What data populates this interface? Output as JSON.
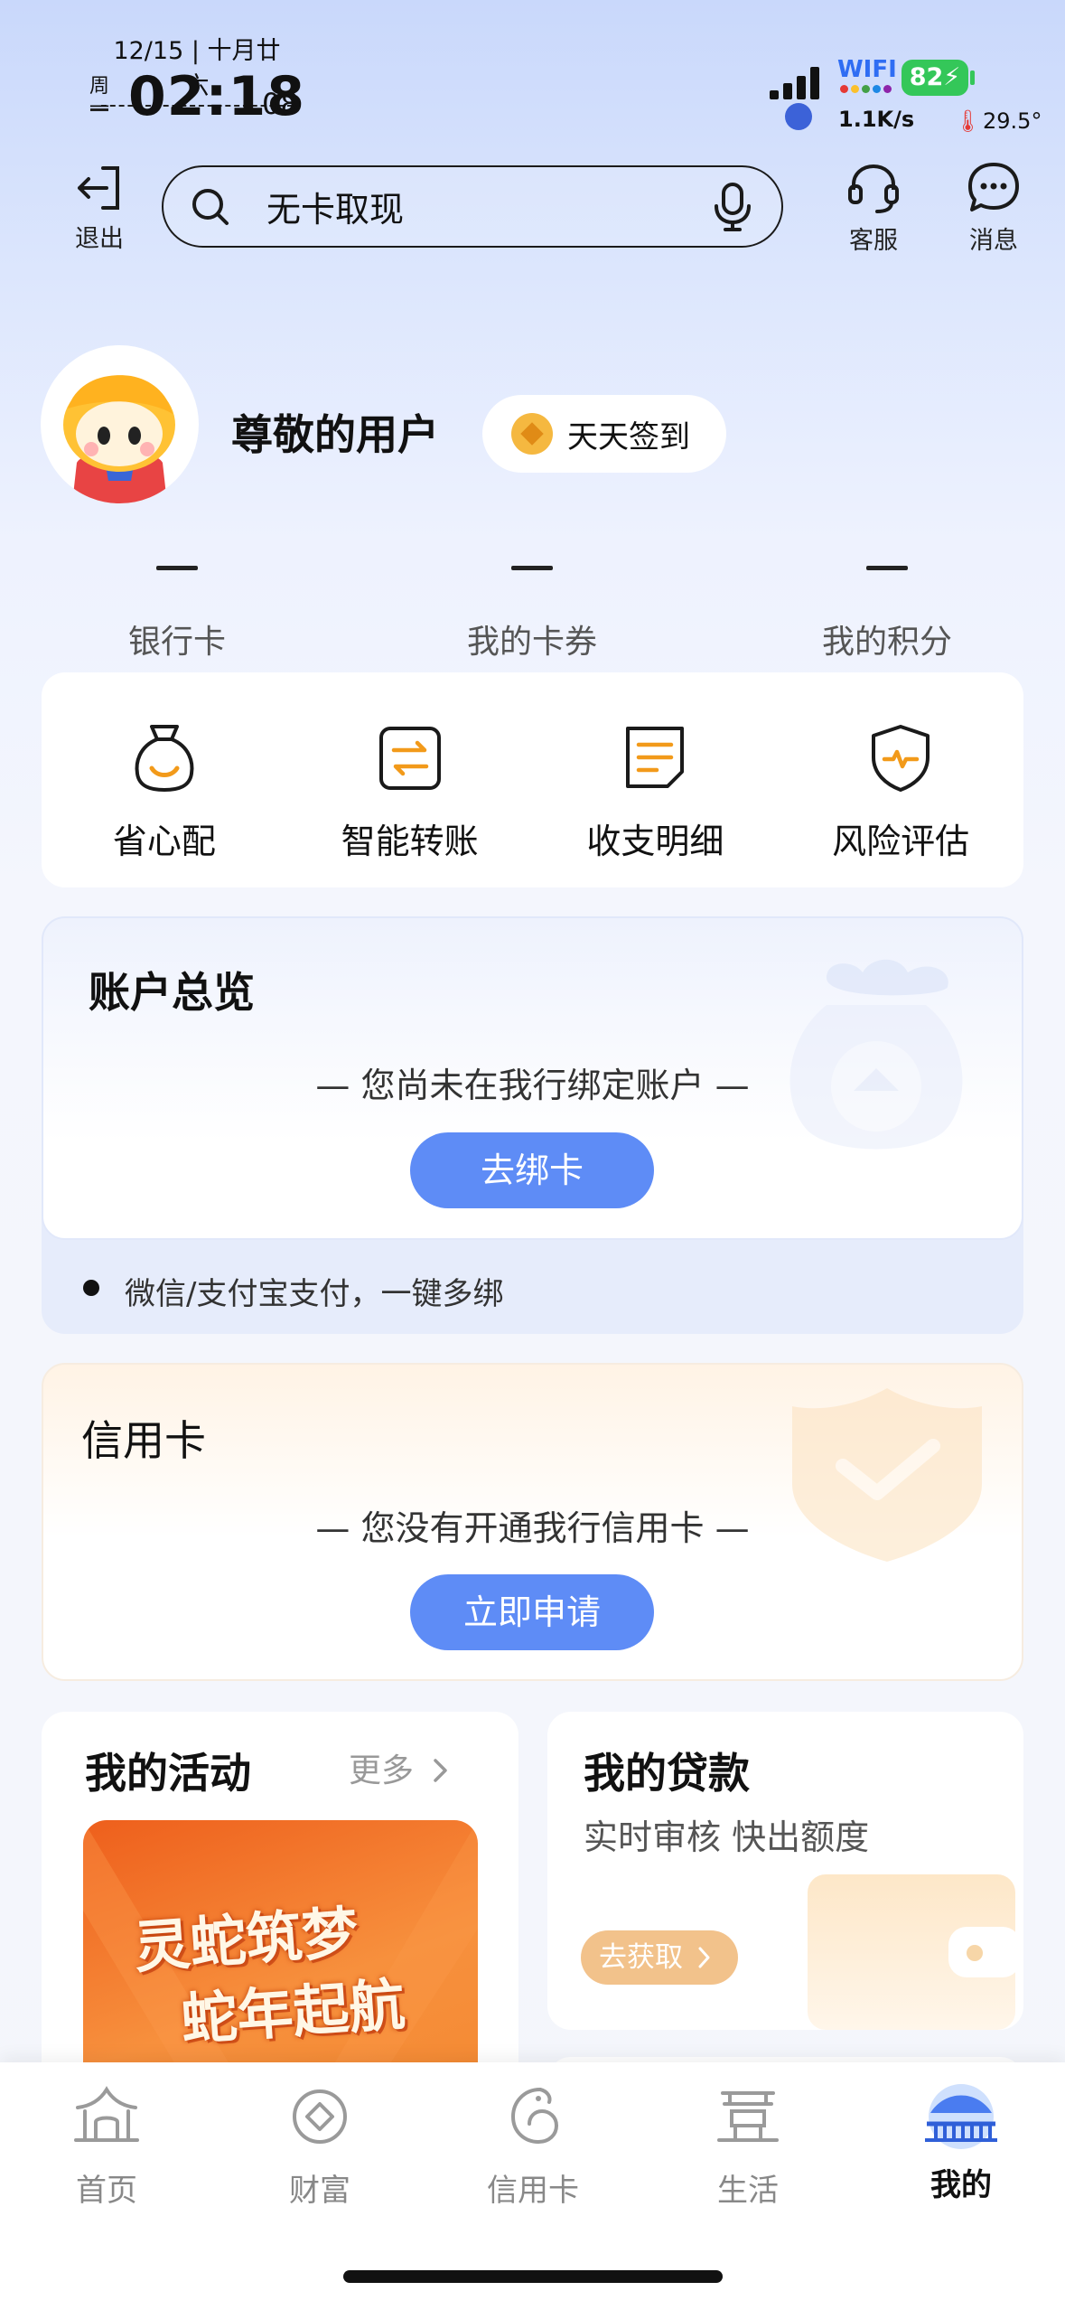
{
  "status_bar": {
    "date": "12/15 | 十月廿六",
    "weekday": "周一",
    "time": "02:18",
    "seconds": "08",
    "wifi_label": "WIFI",
    "battery": "82",
    "net_speed": "1.1K/s",
    "temperature": "29.5°"
  },
  "header": {
    "exit_label": "退出",
    "search_placeholder": "无卡取现",
    "service_label": "客服",
    "message_label": "消息"
  },
  "profile": {
    "username": "尊敬的用户",
    "signin_label": "天天签到"
  },
  "stats": [
    {
      "value": "—",
      "label": "银行卡"
    },
    {
      "value": "—",
      "label": "我的卡券"
    },
    {
      "value": "—",
      "label": "我的积分"
    }
  ],
  "quick_menu": [
    {
      "label": "省心配",
      "icon": "money-bag-icon"
    },
    {
      "label": "智能转账",
      "icon": "transfer-icon"
    },
    {
      "label": "收支明细",
      "icon": "statement-icon"
    },
    {
      "label": "风险评估",
      "icon": "shield-risk-icon"
    }
  ],
  "account": {
    "title": "账户总览",
    "message": "— 您尚未在我行绑定账户 —",
    "button": "去绑卡",
    "tip": "微信/支付宝支付，一键多绑"
  },
  "credit_card": {
    "title": "信用卡",
    "message": "— 您没有开通我行信用卡 —",
    "button": "立即申请"
  },
  "activities": {
    "title": "我的活动",
    "more": "更多",
    "banner_line1": "灵蛇筑梦",
    "banner_line2": "蛇年起航"
  },
  "loan": {
    "title": "我的贷款",
    "subtitle": "实时审核 快出额度",
    "button": "去获取"
  },
  "tabbar": [
    {
      "label": "首页",
      "icon": "home-icon"
    },
    {
      "label": "财富",
      "icon": "wealth-icon"
    },
    {
      "label": "信用卡",
      "icon": "credit-card-icon"
    },
    {
      "label": "生活",
      "icon": "life-icon"
    },
    {
      "label": "我的",
      "icon": "mine-icon",
      "active": true
    }
  ],
  "colors": {
    "accent_blue": "#5e8cf6",
    "battery_green": "#34c759",
    "loan_orange": "#f2c28b"
  }
}
